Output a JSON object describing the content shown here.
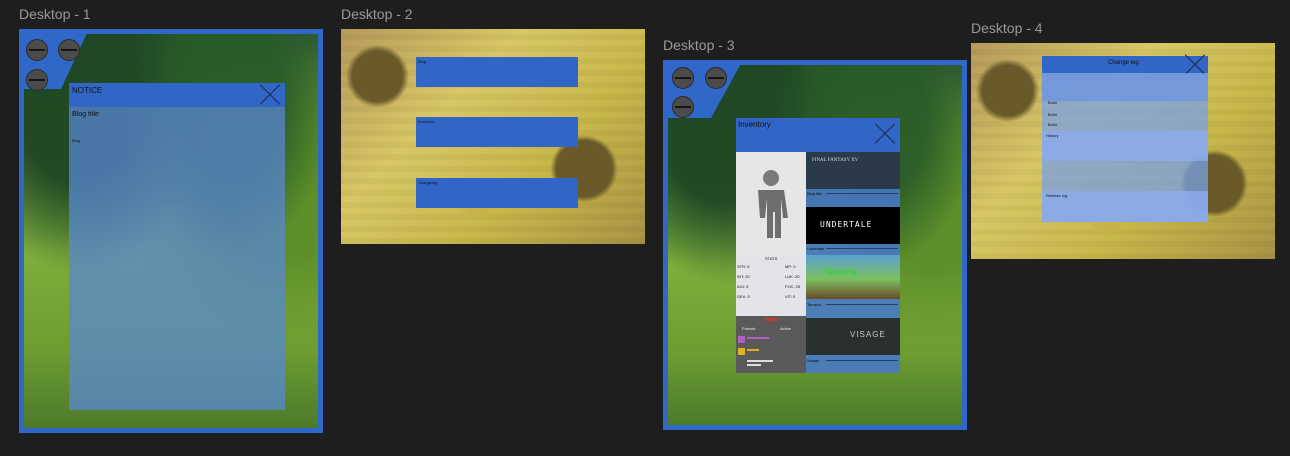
{
  "frames": {
    "desktop1": {
      "label": "Desktop - 1",
      "panel_title": "NOTICE",
      "blog_title": "Blog title",
      "blog_text": "Blog"
    },
    "desktop2": {
      "label": "Desktop - 2",
      "bars": [
        "Blog",
        "Inventory",
        "Changelog"
      ]
    },
    "desktop3": {
      "label": "Desktop - 3",
      "panel_title": "Inventory",
      "stats_title": "STATS",
      "stats": [
        {
          "left": "STR: 5",
          "right": "MP: 0"
        },
        {
          "left": "INT: 20",
          "right": "LUK: 20"
        },
        {
          "left": "AGI: 5",
          "right": "FOC: 25"
        },
        {
          "left": "DEX: 5",
          "right": "VIT: 5"
        }
      ],
      "friends_col_left": "Friends",
      "friends_col_right": "Active",
      "games": [
        {
          "name": "Final Fantasy XV",
          "caption": "Blog title",
          "banner_text": "FINAL FANTASY XV",
          "color": "#2a3a4a"
        },
        {
          "name": "Undertale",
          "caption": "Undertale",
          "banner_text": "UNDERTALE",
          "color": "#000000"
        },
        {
          "name": "Terraria",
          "caption": "Terraria",
          "banner_text": "Terraria",
          "color": "#3a8a3a"
        },
        {
          "name": "Visage",
          "caption": "Visage",
          "banner_text": "VISAGE",
          "color": "#2a2f30"
        }
      ]
    },
    "desktop4": {
      "label": "Desktop - 4",
      "panel_title": "Change log",
      "lines": [
        "Build",
        "Build",
        "Build"
      ],
      "section_a": "History",
      "section_b": "Release log"
    }
  },
  "colors": {
    "accent": "#2f68c8",
    "canvas": "#1e1e1e",
    "label": "#9a9a9a"
  }
}
